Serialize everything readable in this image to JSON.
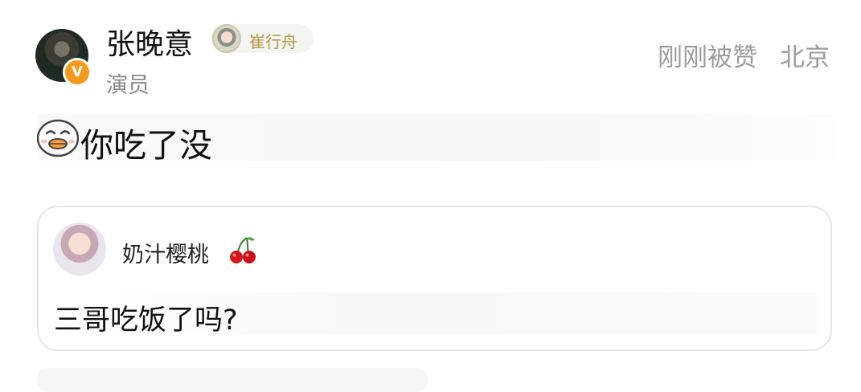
{
  "comment": {
    "author": {
      "name": "张晚意",
      "profession": "演员",
      "verified": true,
      "role_tag": "崔行舟"
    },
    "status": "刚刚被赞",
    "location": "北京",
    "emoji": "duck-face",
    "text": "你吃了没"
  },
  "quoted_comment": {
    "author": {
      "name": "奶汁樱桃",
      "emoji": "cherry"
    },
    "text": "三哥吃饭了吗?"
  },
  "colors": {
    "verified_badge": "#f59a1f",
    "role_tag_text": "#b39a4a",
    "meta_text": "#9c9c9c"
  }
}
